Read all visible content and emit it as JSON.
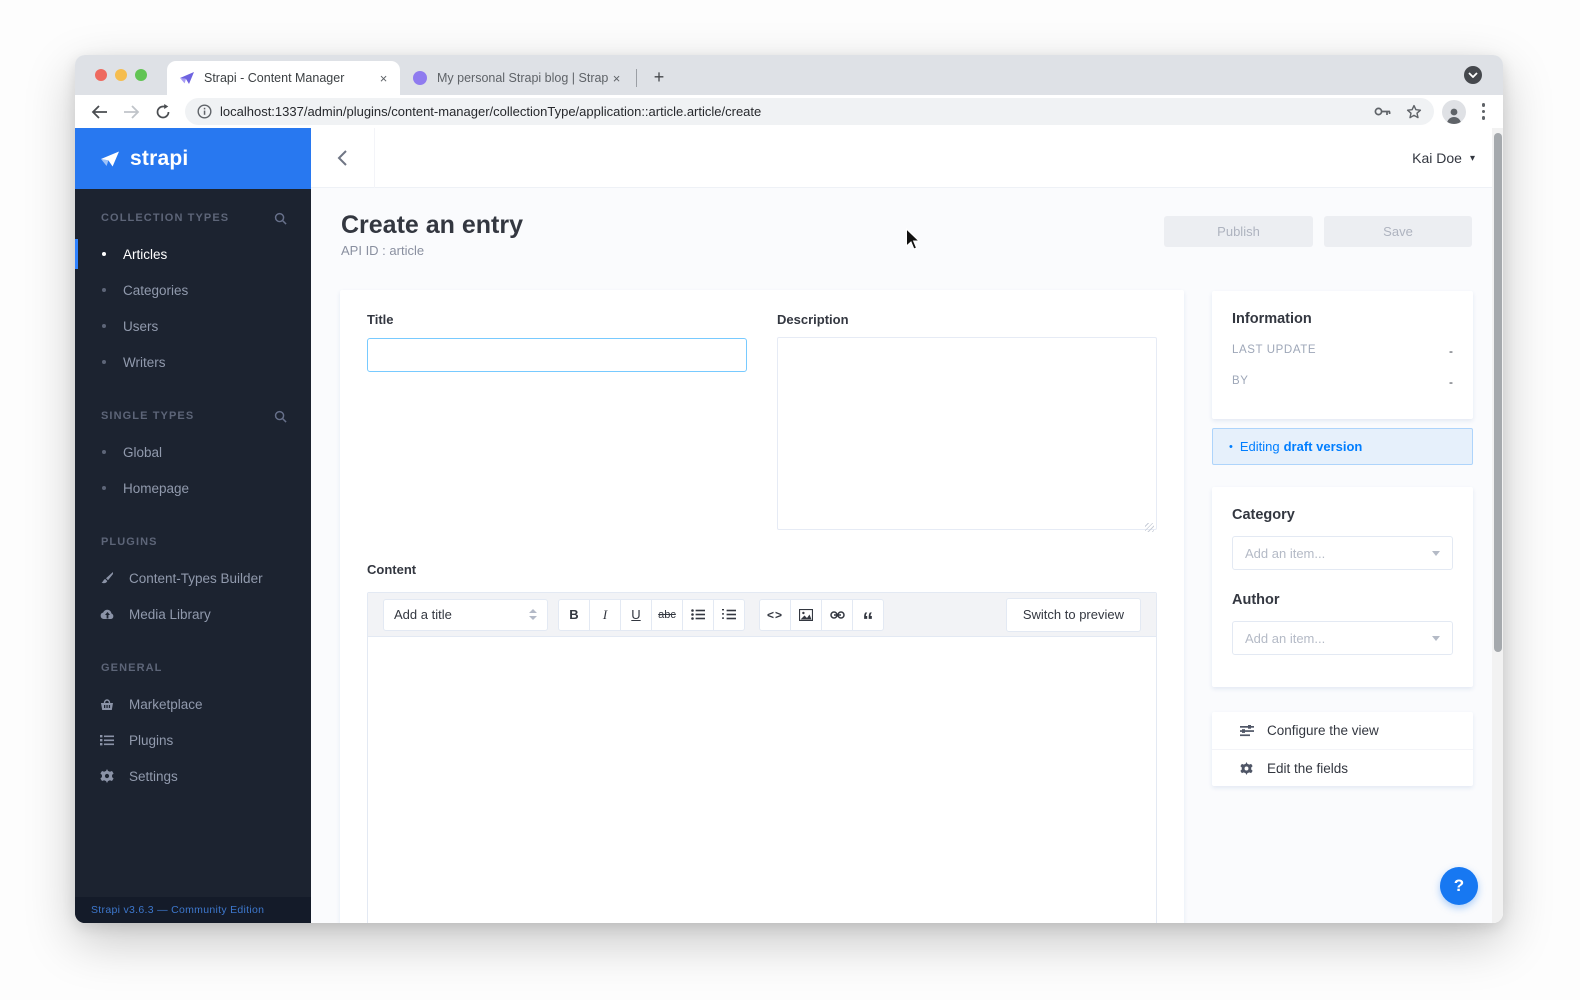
{
  "colors": {
    "accent_blue": "#007eff",
    "brand_blue": "#2878f0",
    "sidebar_bg": "#1c2330",
    "content_bg": "#fafbfd",
    "border": "#e3e9f3",
    "draft_bg": "#e6f0fb",
    "help_bg": "#1778f2"
  },
  "browser": {
    "tabs": [
      {
        "title": "Strapi - Content Manager",
        "active": true
      },
      {
        "title": "My personal Strapi blog | Strap",
        "active": false
      }
    ],
    "url": "localhost:1337/admin/plugins/content-manager/collectionType/application::article.article/create",
    "new_tab_glyph": "+",
    "close_glyph": "×"
  },
  "sidebar": {
    "brand": "strapi",
    "sections": [
      {
        "label": "COLLECTION TYPES",
        "items": [
          {
            "label": "Articles"
          },
          {
            "label": "Categories"
          },
          {
            "label": "Users"
          },
          {
            "label": "Writers"
          }
        ]
      },
      {
        "label": "SINGLE TYPES",
        "items": [
          {
            "label": "Global"
          },
          {
            "label": "Homepage"
          }
        ]
      },
      {
        "label": "PLUGINS",
        "items": [
          {
            "label": "Content-Types Builder",
            "icon": "brush-icon"
          },
          {
            "label": "Media Library",
            "icon": "cloud-upload-icon"
          }
        ]
      },
      {
        "label": "GENERAL",
        "items": [
          {
            "label": "Marketplace",
            "icon": "basket-icon"
          },
          {
            "label": "Plugins",
            "icon": "list-icon"
          },
          {
            "label": "Settings",
            "icon": "gear-icon"
          }
        ]
      }
    ],
    "footer": "Strapi v3.6.3 — Community Edition"
  },
  "header": {
    "back_glyph": "‹",
    "user_name": "Kai Doe",
    "caret_glyph": "▾"
  },
  "page": {
    "title": "Create an entry",
    "subtitle": "API ID : article",
    "publish_label": "Publish",
    "save_label": "Save"
  },
  "form": {
    "title_label": "Title",
    "description_label": "Description",
    "content_label": "Content",
    "editor": {
      "title_select": "Add a title",
      "buttons": {
        "bold": "B",
        "italic": "I",
        "underline": "U",
        "strikethrough": "abc",
        "code": "<>",
        "quote": "“"
      },
      "switch_preview": "Switch to preview"
    }
  },
  "panel": {
    "information": {
      "title": "Information",
      "rows": [
        {
          "label": "LAST UPDATE",
          "value": "-"
        },
        {
          "label": "BY",
          "value": "-"
        }
      ]
    },
    "draft": {
      "bullet": "•",
      "prefix": "Editing",
      "emphasis": "draft version"
    },
    "relations": [
      {
        "label": "Category",
        "placeholder": "Add an item..."
      },
      {
        "label": "Author",
        "placeholder": "Add an item..."
      }
    ],
    "links": [
      {
        "label": "Configure the view",
        "icon": "sliders-icon"
      },
      {
        "label": "Edit the fields",
        "icon": "gear-icon"
      }
    ]
  },
  "help_label": "?"
}
